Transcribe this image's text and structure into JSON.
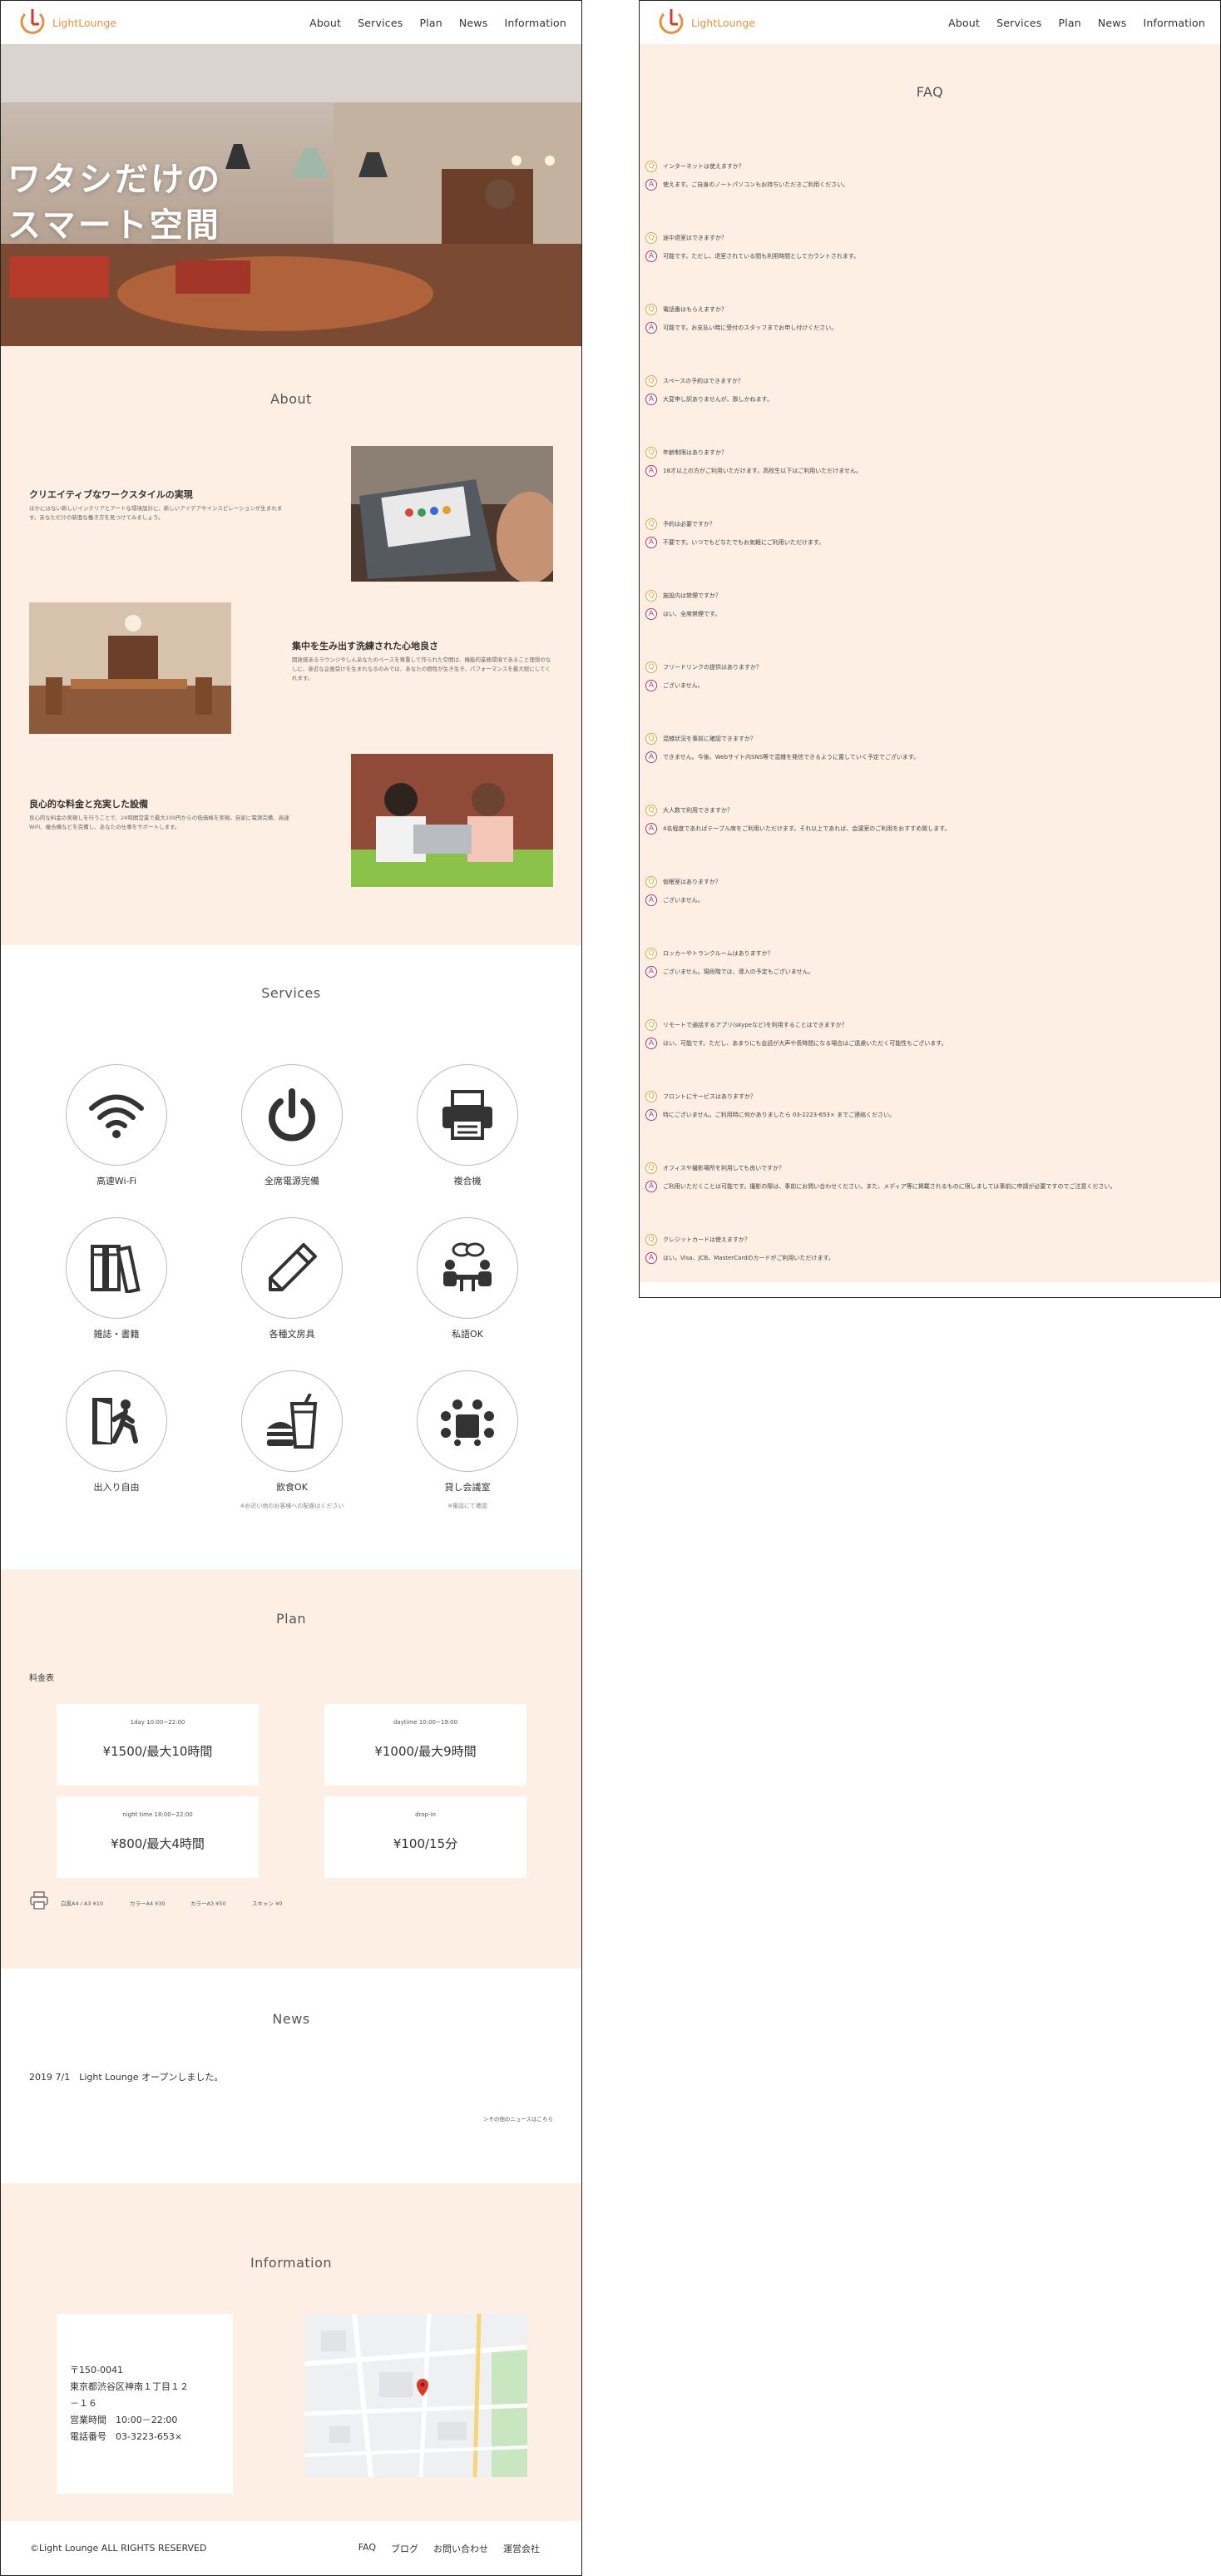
{
  "brand": {
    "name": "LightLounge",
    "accent": "#e9913a",
    "peach": "#fdefe4",
    "answer_color": "#b8365a",
    "question_color": "#e8a23a"
  },
  "nav": [
    "About",
    "Services",
    "Plan",
    "News",
    "Information"
  ],
  "hero": {
    "line1": "ワタシだけの",
    "line2": "スマート空間"
  },
  "about": {
    "title": "About",
    "features": [
      {
        "heading": "クリエイティブなワークスタイルの実現",
        "text": "ほかにはない新しいインテリアとアートな環境設計に、新しいアイデアやインスピレーションが生まれます。あなただけの新面な働き方を見つけてみましょう。"
      },
      {
        "heading": "集中を生み出す洗練された心地良さ",
        "text": "開放感あるラウンジやしんあなたのペースを尊重して作られた空間は、機能的業務環境であること理想のなしに、身近な企画受けを生まれなるのみでは、あなたの個性が生き生き、パフォーマンスを最大限にしてくれます。"
      },
      {
        "heading": "良心的な料金と充実した設備",
        "text": "良心的な料金の実現しを行うことで、24時間営業で最大100円からの低価格を実現。自家に電源完備、高速WiFi、複合機などを完備し、あなたの仕事をサポートします。"
      }
    ]
  },
  "services": {
    "title": "Services",
    "items": [
      {
        "label": "高速Wi-Fi",
        "icon": "wifi-icon"
      },
      {
        "label": "全席電源完備",
        "icon": "power-icon"
      },
      {
        "label": "複合機",
        "icon": "printer-icon"
      },
      {
        "label": "雑誌・書籍",
        "icon": "books-icon"
      },
      {
        "label": "各種文房具",
        "icon": "pencil-icon"
      },
      {
        "label": "私語OK",
        "icon": "chat-icon"
      },
      {
        "label": "出入り自由",
        "icon": "exit-icon"
      },
      {
        "label": "飲食OK",
        "icon": "food-icon",
        "note": "※お近い他のお客様への配慮はください"
      },
      {
        "label": "貸し会議室",
        "icon": "meeting-icon",
        "note": "※電話にて確認"
      }
    ]
  },
  "plan": {
    "title": "Plan",
    "subtitle": "料金表",
    "plans": [
      {
        "label": "1day 10:00~22:00",
        "price": "¥1500/最大10時間"
      },
      {
        "label": "daytime 10:00~19:00",
        "price": "¥1000/最大9時間"
      },
      {
        "label": "night time 18:00~22:00",
        "price": "¥800/最大4時間"
      },
      {
        "label": "drop-in",
        "price": "¥100/15分"
      }
    ],
    "copy_options": [
      "白黒A4 / A3 ¥10",
      "カラーA4 ¥30",
      "カラーA3 ¥50",
      "スキャン ¥0"
    ]
  },
  "news": {
    "title": "News",
    "items": [
      "2019 7/1　Light Lounge オープンしました。"
    ],
    "more": "＞その他のニュースはこちら"
  },
  "info": {
    "title": "Information",
    "lines": [
      "〒150-0041",
      "東京都渋谷区神南１丁目１２",
      "－１６",
      "営業時間　10:00－22:00",
      "電話番号　03-3223-653×"
    ]
  },
  "footer": {
    "copyright": "©Light Lounge ALL RIGHTS RESERVED",
    "links": [
      "FAQ",
      "ブログ",
      "お問い合わせ",
      "運営会社"
    ]
  },
  "faq": {
    "title": "FAQ",
    "items": [
      {
        "q": "インターネットは使えますか？",
        "a": "使えます。ご自身のノートパソコンもお持ちいただきご利用ください。"
      },
      {
        "q": "途中退室はできますか？",
        "a": "可能です。ただし、退室されている間も利用時間としてカウントされます。"
      },
      {
        "q": "電話番はもらえますか？",
        "a": "可能です。お支払い時に受付のスタッフまでお申し付けください。"
      },
      {
        "q": "スペースの予約はできますか？",
        "a": "大変申し訳ありませんが、致しかねます。"
      },
      {
        "q": "年齢制限はありますか？",
        "a": "18才以上の方がご利用いただけます。高校生以下はご利用いただけません。"
      },
      {
        "q": "予約は必要ですか？",
        "a": "不要です。いつでもどなたでもお気軽にご利用いただけます。"
      },
      {
        "q": "施設内は禁煙ですか？",
        "a": "はい、全席禁煙です。"
      },
      {
        "q": "フリードリンクの提供はありますか？",
        "a": "ございません。"
      },
      {
        "q": "混雑状況を事前に確認できますか？",
        "a": "できません。今後、Webサイト内SNS等で混雑を発信できるように置していく予定でございます。"
      },
      {
        "q": "大人数で利用できますか？",
        "a": "4名程度であればテーブル席をご利用いただけます。それ以上であれば、会議室のご利用をおすすめ致します。"
      },
      {
        "q": "仮眠室はありますか？",
        "a": "ございません。"
      },
      {
        "q": "ロッカーやトランクルームはありますか？",
        "a": "ございません。現段階では、導入の予定もございません。"
      },
      {
        "q": "リモートで通話するアプリ(skypeなど)を利用することはできますか？",
        "a": "はい、可能です。ただし、あまりにも会話が大声や長時間になる場合はご遠慮いただく可能性もございます。"
      },
      {
        "q": "フロントにサービスはありますか？",
        "a": "特にございません。ご利用時に何かありましたら 03-2223-653× までご連絡ください。"
      },
      {
        "q": "オフィスや撮影場所を利用しても良いですか？",
        "a": "ご利用いただくことは可能です。撮影の際は、事前にお問い合わせください。また、メディア等に掲載されるものに限しましては事前に申請が必要ですのでご注意ください。"
      },
      {
        "q": "クレジットカードは使えますか？",
        "a": "はい。Visa、JCB、MasterCardのカードがご利用いただけます。"
      }
    ]
  }
}
